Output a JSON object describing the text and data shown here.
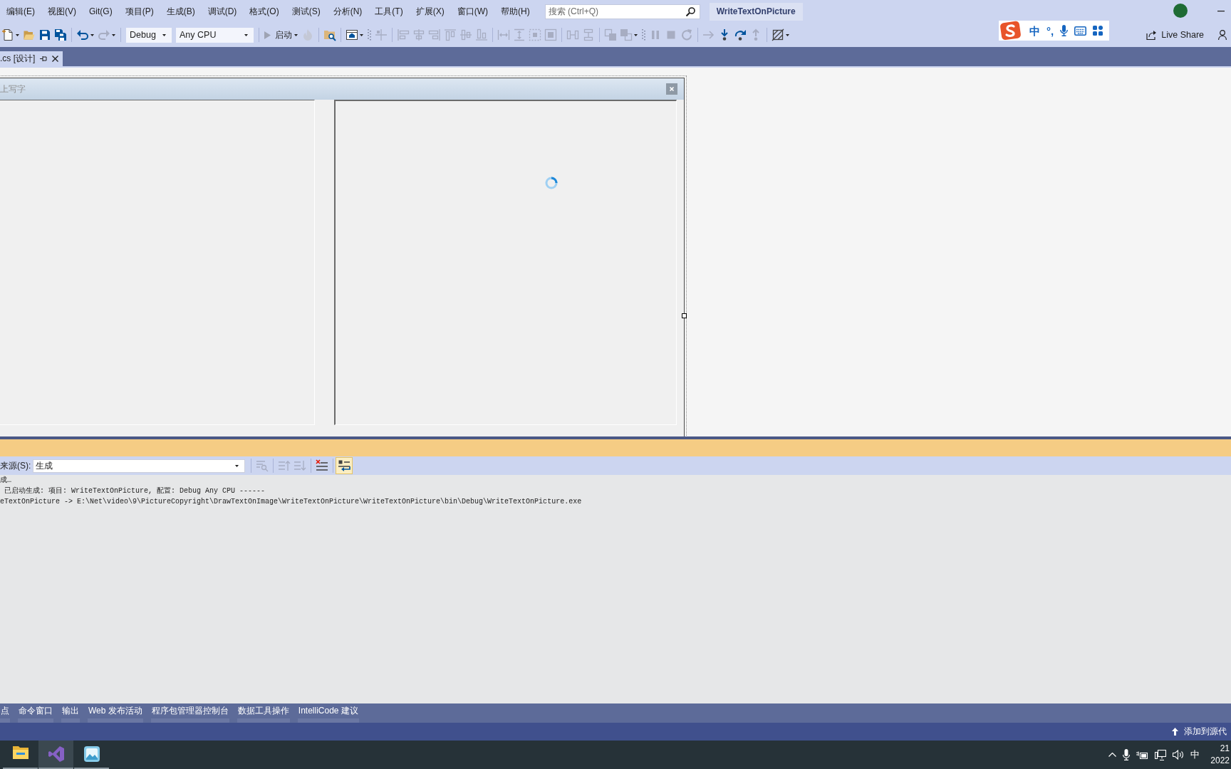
{
  "menu_bar": {
    "items": [
      "编辑(E)",
      "视图(V)",
      "Git(G)",
      "项目(P)",
      "生成(B)",
      "调试(D)",
      "格式(O)",
      "测试(S)",
      "分析(N)",
      "工具(T)",
      "扩展(X)",
      "窗口(W)",
      "帮助(H)"
    ],
    "search": {
      "placeholder": "搜索 (Ctrl+Q)"
    },
    "solution_name": "WriteTextOnPicture"
  },
  "toolbar": {
    "items": [
      {
        "kind": "new",
        "disabled": false,
        "dropdown": true
      },
      {
        "kind": "open",
        "disabled": false,
        "dropdown": false
      },
      {
        "kind": "save",
        "disabled": false,
        "dropdown": false
      },
      {
        "kind": "save-all",
        "disabled": false,
        "dropdown": false
      },
      {
        "kind": "separator"
      },
      {
        "kind": "undo",
        "disabled": false,
        "dropdown": true
      },
      {
        "kind": "redo",
        "disabled": true,
        "dropdown": true
      },
      {
        "kind": "separator"
      },
      {
        "kind": "select",
        "value": "Debug"
      },
      {
        "kind": "select",
        "value": "Any CPU"
      },
      {
        "kind": "separator"
      },
      {
        "kind": "start",
        "label": "启动",
        "disabled": false,
        "dropdown": true
      },
      {
        "kind": "hot-reload",
        "disabled": true,
        "dropdown": false
      },
      {
        "kind": "separator"
      },
      {
        "kind": "folder-search",
        "disabled": false,
        "dropdown": false
      },
      {
        "kind": "separator"
      },
      {
        "kind": "form-view",
        "disabled": false,
        "dropdown": true
      },
      {
        "kind": "grip"
      },
      {
        "kind": "align-grid",
        "disabled": true,
        "dropdown": false
      },
      {
        "kind": "separator"
      },
      {
        "kind": "align-left",
        "disabled": true,
        "dropdown": false
      },
      {
        "kind": "align-center",
        "disabled": true,
        "dropdown": false
      },
      {
        "kind": "align-right",
        "disabled": true,
        "dropdown": false
      },
      {
        "kind": "align-top",
        "disabled": true,
        "dropdown": false
      },
      {
        "kind": "align-middle",
        "disabled": true,
        "dropdown": false
      },
      {
        "kind": "align-bottom",
        "disabled": true,
        "dropdown": false
      },
      {
        "kind": "separator"
      },
      {
        "kind": "same-width",
        "disabled": true,
        "dropdown": false
      },
      {
        "kind": "same-height",
        "disabled": true,
        "dropdown": false
      },
      {
        "kind": "size-grid",
        "disabled": true,
        "dropdown": false
      },
      {
        "kind": "same-size",
        "disabled": true,
        "dropdown": false
      },
      {
        "kind": "separator"
      },
      {
        "kind": "h-space",
        "disabled": true,
        "dropdown": false
      },
      {
        "kind": "v-space",
        "disabled": true,
        "dropdown": false
      },
      {
        "kind": "separator"
      },
      {
        "kind": "bring-front",
        "disabled": true,
        "dropdown": false
      },
      {
        "kind": "send-back",
        "disabled": true,
        "dropdown": true
      },
      {
        "kind": "grip"
      },
      {
        "kind": "pause",
        "disabled": true,
        "dropdown": false
      },
      {
        "kind": "stop",
        "disabled": true,
        "dropdown": false
      },
      {
        "kind": "restart",
        "disabled": true,
        "dropdown": false
      },
      {
        "kind": "separator"
      },
      {
        "kind": "show-next",
        "disabled": true,
        "dropdown": false
      },
      {
        "kind": "step-into",
        "disabled": false,
        "dropdown": false
      },
      {
        "kind": "step-over",
        "disabled": false,
        "dropdown": false
      },
      {
        "kind": "step-out",
        "disabled": true,
        "dropdown": false
      },
      {
        "kind": "separator"
      },
      {
        "kind": "hatch",
        "disabled": false,
        "dropdown": true
      }
    ],
    "live_share": "Live Share"
  },
  "ime_bar": {
    "mode": "中",
    "punctuation": "°,"
  },
  "document_tabs": [
    {
      "label": ".cs [设计]",
      "selected": true
    }
  ],
  "designer": {
    "form_title": "上写字"
  },
  "output": {
    "source_label": "来源(S):",
    "source": "生成",
    "tools": [
      {
        "kind": "separator"
      },
      {
        "kind": "find-message",
        "disabled": true,
        "on": false
      },
      {
        "kind": "separator"
      },
      {
        "kind": "prev-message",
        "disabled": true,
        "on": false
      },
      {
        "kind": "next-message",
        "disabled": true,
        "on": false
      },
      {
        "kind": "separator"
      },
      {
        "kind": "clear-all",
        "disabled": false,
        "on": false
      },
      {
        "kind": "separator"
      },
      {
        "kind": "word-wrap",
        "disabled": false,
        "on": true
      }
    ],
    "lines": [
      "成…",
      " 已启动生成: 项目: WriteTextOnPicture, 配置: Debug Any CPU ------",
      "eTextOnPicture -> E:\\Net\\video\\9\\PictureCopyright\\DrawTextOnImage\\WriteTextOnPicture\\WriteTextOnPicture\\bin\\Debug\\WriteTextOnPicture.exe"
    ]
  },
  "tool_tabs": [
    "点",
    "命令窗口",
    "输出",
    "Web 发布活动",
    "程序包管理器控制台",
    "数据工具操作",
    "IntelliCode 建议"
  ],
  "status_bar": {
    "action": "添加到源代"
  },
  "taskbar": {
    "apps": [
      {
        "kind": "file-explorer",
        "active": false
      },
      {
        "kind": "visual-studio",
        "active": true
      },
      {
        "kind": "image-app",
        "active": false
      }
    ],
    "tray": {
      "ime": "中",
      "time": "21",
      "date": "2022"
    }
  }
}
